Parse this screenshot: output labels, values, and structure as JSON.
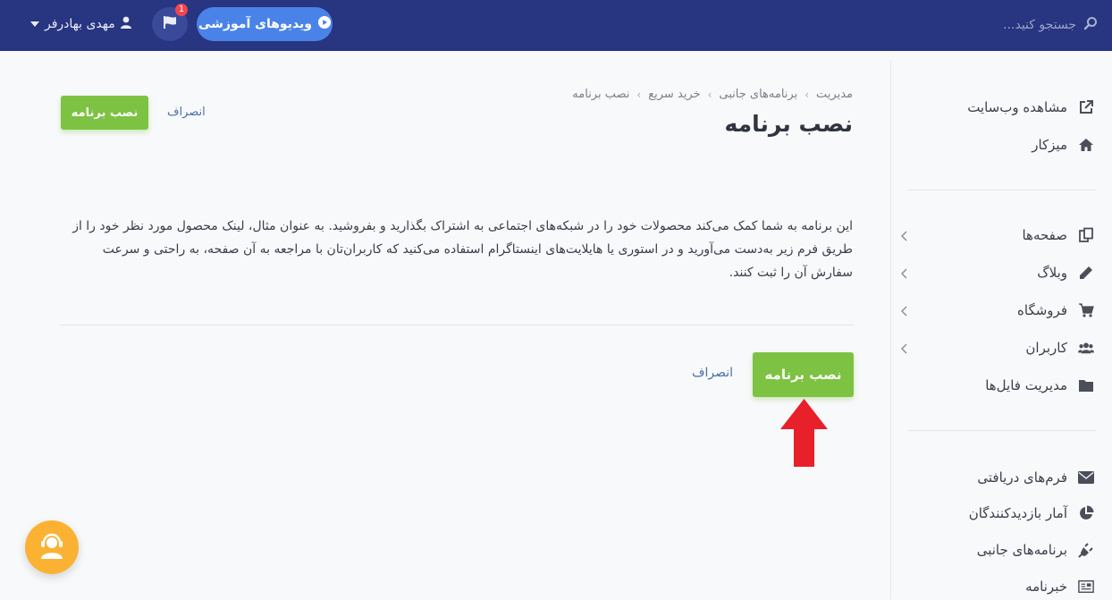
{
  "topbar": {
    "search_placeholder": "جستجو کنید...",
    "user_name": "مهدی بهادرفر",
    "notification_count": "1",
    "video_button_label": "ویدیوهای آموزشی",
    "colors": {
      "background": "#283580",
      "video_button": "#4a83e8",
      "badge": "#f04550"
    }
  },
  "sidebar": {
    "group1": [
      {
        "label": "مشاهده وب‌سایت",
        "icon": "external-link-icon"
      },
      {
        "label": "میزکار",
        "icon": "home-icon"
      }
    ],
    "group2": [
      {
        "label": "صفحه‌ها",
        "icon": "pages-icon",
        "expandable": true
      },
      {
        "label": "وبلاگ",
        "icon": "pencil-icon",
        "expandable": true
      },
      {
        "label": "فروشگاه",
        "icon": "cart-icon",
        "expandable": true
      },
      {
        "label": "کاربران",
        "icon": "users-icon",
        "expandable": true
      },
      {
        "label": "مدیریت فایل‌ها",
        "icon": "folder-icon",
        "expandable": false
      }
    ],
    "group3": [
      {
        "label": "فرم‌های دریافتی",
        "icon": "envelope-icon"
      },
      {
        "label": "آمار بازدیدکنندگان",
        "icon": "pie-chart-icon"
      },
      {
        "label": "برنامه‌های جانبی",
        "icon": "plug-icon"
      },
      {
        "label": "خبرنامه",
        "icon": "newspaper-icon"
      }
    ]
  },
  "breadcrumb": [
    "مدیریت",
    "برنامه‌های جانبی",
    "خرید سریع",
    "نصب برنامه"
  ],
  "page": {
    "title": "نصب برنامه",
    "install_label": "نصب برنامه",
    "cancel_label": "انصراف",
    "description": "این برنامه به شما کمک می‌کند محصولات خود را در شبکه‌های اجتماعی به اشتراک بگذارید و بفروشید. به عنوان مثال، لینک محصول مورد نظر خود را از طریق فرم زیر به‌دست می‌آورید و در استوری یا هایلایت‌های اینستاگرام استفاده می‌کنید که کاربران‌تان با مراجعه به آن صفحه، به راحتی و سرعت سفارش آن را ثبت کنند."
  },
  "colors": {
    "accent_green": "#7dc242",
    "arrow_red": "#e8202a",
    "support": "#fbb233",
    "link_blue": "#4a6fa8"
  }
}
